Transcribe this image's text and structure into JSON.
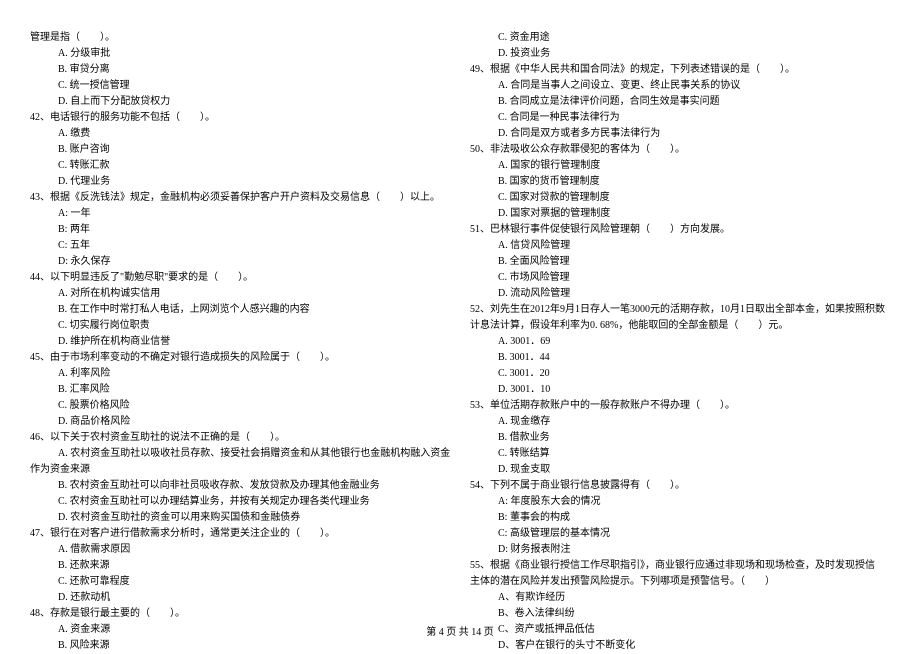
{
  "left": {
    "q41_stem_cont": "管理是指（　　）。",
    "q41_a": "A. 分级审批",
    "q41_b": "B. 审贷分离",
    "q41_c": "C. 统一授信管理",
    "q41_d": "D. 自上而下分配放贷权力",
    "q42": "42、电话银行的服务功能不包括（　　）。",
    "q42_a": "A. 缴费",
    "q42_b": "B. 账户咨询",
    "q42_c": "C. 转账汇款",
    "q42_d": "D. 代理业务",
    "q43": "43、根据《反洗钱法》规定，金融机构必须妥善保护客户开户资料及交易信息（　　）以上。",
    "q43_a": "A: 一年",
    "q43_b": "B: 两年",
    "q43_c": "C: 五年",
    "q43_d": "D: 永久保存",
    "q44": "44、以下明显违反了\"勤勉尽职\"要求的是（　　）。",
    "q44_a": "A. 对所在机构诚实信用",
    "q44_b": "B. 在工作中时常打私人电话，上网浏览个人感兴趣的内容",
    "q44_c": "C. 切实履行岗位职责",
    "q44_d": "D. 维护所在机构商业信誉",
    "q45": "45、由于市场利率变动的不确定对银行造成损失的风险属于（　　）。",
    "q45_a": "A. 利率风险",
    "q45_b": "B. 汇率风险",
    "q45_c": "C. 股票价格风险",
    "q45_d": "D. 商品价格风险",
    "q46": "46、以下关于农村资金互助社的说法不正确的是（　　）。",
    "q46_a_l1": "A. 农村资金互助社以吸收社员存款、接受社会捐赠资金和从其他银行也金融机构融入资金",
    "q46_a_l2": "作为资金来源",
    "q46_b": "B. 农村资金互助社可以向非社员吸收存款、发放贷款及办理其他金融业务",
    "q46_c": "C. 农村资金互助社可以办理结算业务，并按有关规定办理各类代理业务",
    "q46_d": "D. 农村资金互助社的资金可以用来购买国债和金融债券",
    "q47": "47、银行在对客户进行借款需求分析时，通常更关注企业的（　　）。",
    "q47_a": "A. 借款需求原因",
    "q47_b": "B. 还款来源",
    "q47_c": "C. 还款可靠程度",
    "q47_d": "D. 还款动机",
    "q48": "48、存款是银行最主要的（　　）。",
    "q48_a": "A. 资金来源",
    "q48_b": "B. 风险来源"
  },
  "right": {
    "q48_c": "C. 资金用途",
    "q48_d": "D. 投资业务",
    "q49": "49、根据《中华人民共和国合同法》的规定，下列表述错误的是（　　）。",
    "q49_a": "A. 合同是当事人之间设立、变更、终止民事关系的协议",
    "q49_b": "B. 合同成立是法律评价问题，合同生效是事实问题",
    "q49_c": "C. 合同是一种民事法律行为",
    "q49_d": "D. 合同是双方或者多方民事法律行为",
    "q50": "50、非法吸收公众存款罪侵犯的客体为（　　）。",
    "q50_a": "A. 国家的银行管理制度",
    "q50_b": "B. 国家的货币管理制度",
    "q50_c": "C. 国家对贷款的管理制度",
    "q50_d": "D. 国家对票据的管理制度",
    "q51": "51、巴林银行事件促使银行风险管理朝（　　）方向发展。",
    "q51_a": "A. 信贷风险管理",
    "q51_b": "B. 全面风险管理",
    "q51_c": "C. 市场风险管理",
    "q51_d": "D. 流动风险管理",
    "q52_l1": "52、刘先生在2012年9月1日存人一笔3000元的活期存款，10月1日取出全部本金，如果按照积数",
    "q52_l2": "计息法计算，假设年利率为0. 68%，他能取回的全部金额是（　　）元。",
    "q52_a": "A. 3001．69",
    "q52_b": "B. 3001．44",
    "q52_c": "C. 3001．20",
    "q52_d": "D. 3001．10",
    "q53": "53、单位活期存款账户中的一般存款账户不得办理（　　）。",
    "q53_a": "A. 现金缴存",
    "q53_b": "B. 借款业务",
    "q53_c": "C. 转账结算",
    "q53_d": "D. 现金支取",
    "q54": "54、下列不属于商业银行信息披露得有（　　）。",
    "q54_a": "A: 年度股东大会的情况",
    "q54_b": "B: 董事会的构成",
    "q54_c": "C: 高级管理层的基本情况",
    "q54_d": "D: 财务报表附注",
    "q55_l1": "55、根据《商业银行授信工作尽职指引》，商业银行应通过非现场和现场检查，及时发现授信",
    "q55_l2": "主体的潜在风险并发出预警风险提示。下列哪项是预警信号。（　　）",
    "q55_a": "A、有欺诈经历",
    "q55_b": "B、卷入法律纠纷",
    "q55_c": "C、资产或抵押品低估",
    "q55_d": "D、客户在银行的头寸不断变化"
  },
  "footer": "第 4 页 共 14 页"
}
